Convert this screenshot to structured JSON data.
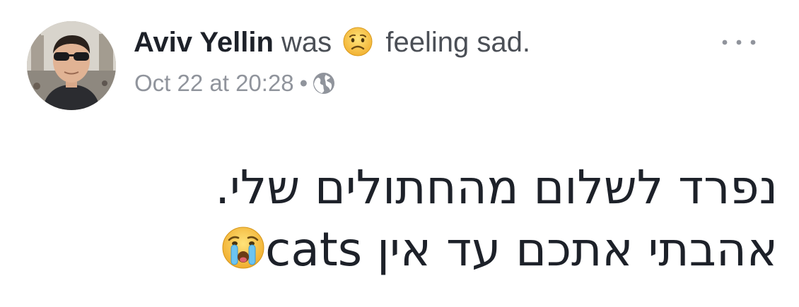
{
  "post": {
    "author": "Aviv Yellin",
    "activity_prefix": "was",
    "activity_emoji": "sad-face-emoji",
    "activity_suffix": "feeling sad.",
    "timestamp": "Oct 22 at 20:28",
    "separator": "•",
    "privacy_icon": "globe-icon",
    "more_icon": "more-options-icon",
    "text_lines": [
      "נפרד לשלום מהחתולים שלי.",
      "אהבתי אתכם עד אין cats"
    ],
    "text_emoji": "crying-face-emoji"
  },
  "colors": {
    "primary_text": "#1d2129",
    "secondary_text": "#4b4f56",
    "meta_text": "#90949c",
    "emoji_yellow": "#f7c948"
  }
}
